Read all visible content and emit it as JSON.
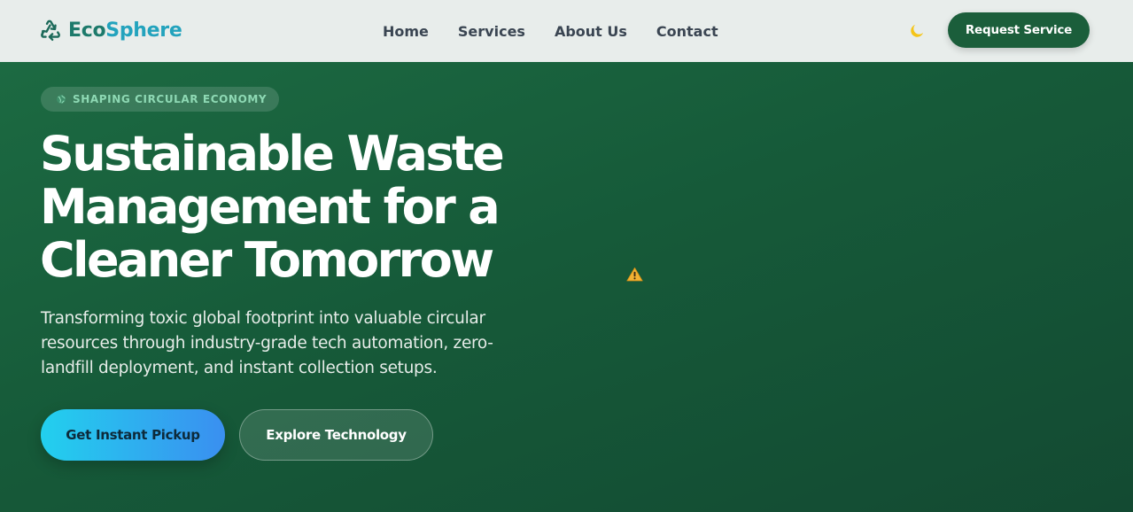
{
  "brand": {
    "name_primary": "Eco",
    "name_accent": "Sphere",
    "icon": "recycle-icon"
  },
  "nav": {
    "links": [
      {
        "label": "Home"
      },
      {
        "label": "Services"
      },
      {
        "label": "About Us"
      },
      {
        "label": "Contact"
      }
    ],
    "theme_toggle_icon": "moon-icon",
    "cta_label": "Request Service"
  },
  "hero": {
    "badge": "SHAPING CIRCULAR ECONOMY",
    "badge_icon": "globe-icon",
    "headline_lines": [
      "Sustainable Waste",
      "Management for a",
      "Cleaner Tomorrow"
    ],
    "subtext": "Transforming toxic global footprint into valuable circular resources through industry-grade tech automation, zero-landfill deployment, and instant collection setups.",
    "primary_button": "Get Instant Pickup",
    "secondary_button": "Explore Technology",
    "media_placeholder_icon": "warning-icon"
  },
  "colors": {
    "nav_bg": "#e8edeb",
    "brand_teal": "#1d7a6b",
    "brand_cyan": "#23a3bd",
    "hero_green": "#1a5c3b",
    "cta_green": "#1b5e3b",
    "moon_yellow": "#f5c518",
    "primary_gradient_start": "#22d0ee",
    "primary_gradient_end": "#3a8ff0"
  }
}
